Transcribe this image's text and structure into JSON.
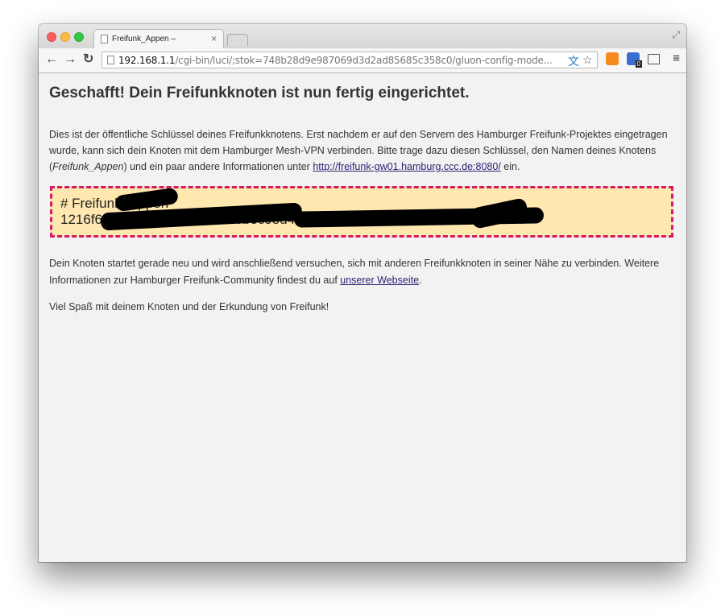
{
  "browser": {
    "tab": {
      "title": "Freifunk_Appen –",
      "close": "×"
    },
    "url": {
      "host": "192.168.1.1",
      "path": "/cgi-bin/luci/;stok=748b28d9e987069d3d2ad85685c358c0/gluon-config-mode..."
    },
    "nav": {
      "back": "←",
      "forward": "→",
      "reload": "↻"
    },
    "menu_icon": "≡",
    "extensions": [
      "translate-icon",
      "bookmark-star-icon",
      "fox-extension-icon",
      "ghostery-icon",
      "cast-icon"
    ],
    "ghostery_badge": "0"
  },
  "page": {
    "heading": "Geschafft! Dein Freifunkknoten ist nun fertig eingerichtet.",
    "intro": {
      "text1": "Dies ist der öffentliche Schlüssel deines Freifunkknotens. Erst nachdem er auf den Servern des Hamburger Freifunk-Projektes eingetragen wurde, kann sich dein Knoten mit dem Hamburger Mesh-VPN verbinden. Bitte trage dazu diesen Schlüssel, den Namen deines Knotens (",
      "node_name": "Freifunk_Appen",
      "text2": ") und ein paar andere Informationen unter ",
      "link": "http://freifunk-gw01.hamburg.ccc.de:8080/",
      "text3": " ein."
    },
    "key": {
      "line1": "# Freifunk_Appen",
      "line2": "1216f6e0a3c4b59d8e27f10a6b3c95d4e8f72a1b0c6d93e5f4a2b7c8d91e0f37"
    },
    "restart": {
      "text1": "Dein Knoten startet gerade neu und wird anschließend versuchen, sich mit anderen Freifunkknoten in seiner Nähe zu verbinden. Weitere Informationen zur Hamburger Freifunk-Community findest du auf ",
      "link": "unserer Webseite",
      "text2": "."
    },
    "closing": "Viel Spaß mit deinem Knoten und der Erkundung von Freifunk!"
  },
  "colors": {
    "key_background": "#ffe7b0",
    "key_border": "#d5186b",
    "link": "#2b1f75"
  }
}
